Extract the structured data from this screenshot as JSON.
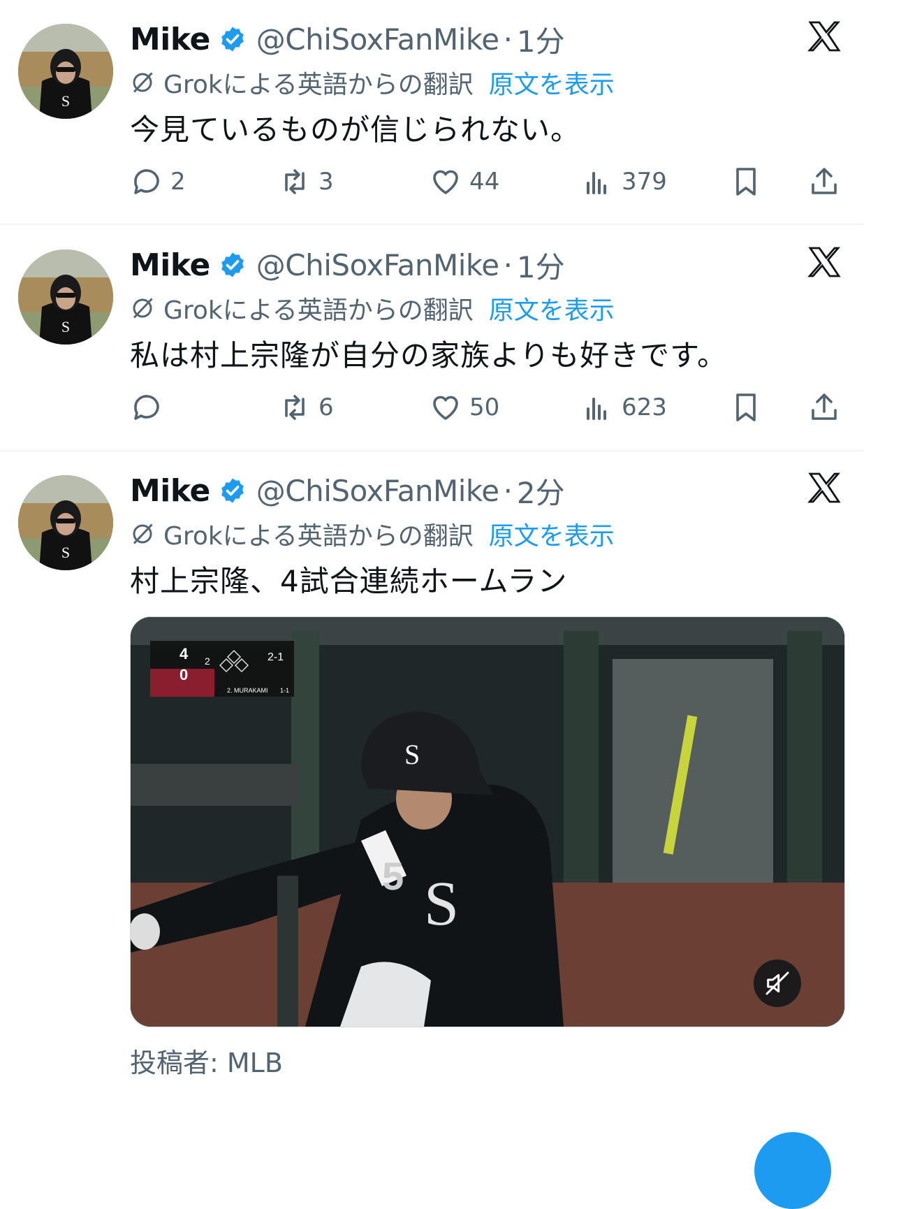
{
  "tweets": [
    {
      "author_name": "Mike",
      "handle": "@ChiSoxFanMike",
      "separator": "·",
      "time": "1分",
      "translation_label": "Grokによる英語からの翻訳",
      "show_original_label": "原文を表示",
      "text": "今見ているものが信じられない。",
      "replies": "2",
      "reposts": "3",
      "likes": "44",
      "views": "379"
    },
    {
      "author_name": "Mike",
      "handle": "@ChiSoxFanMike",
      "separator": "·",
      "time": "1分",
      "translation_label": "Grokによる英語からの翻訳",
      "show_original_label": "原文を表示",
      "text": "私は村上宗隆が自分の家族よりも好きです。",
      "replies": "",
      "reposts": "6",
      "likes": "50",
      "views": "623"
    },
    {
      "author_name": "Mike",
      "handle": "@ChiSoxFanMike",
      "separator": "·",
      "time": "2分",
      "translation_label": "Grokによる英語からの翻訳",
      "show_original_label": "原文を表示",
      "text": "村上宗隆、4試合連続ホームラン",
      "media": {
        "scoreboard": {
          "away_score": "4",
          "home_score": "0",
          "inning": "2",
          "count": "2-1",
          "batter": "2. MURAKAMI",
          "batter_stat": "1-1"
        },
        "jersey_number": "5"
      },
      "attribution": "投稿者: MLB"
    }
  ],
  "colors": {
    "accent": "#1d9bf0",
    "secondary_text": "#536471",
    "primary_text": "#0f1419",
    "divider": "#eff3f4"
  },
  "icons": [
    "verified-badge-icon",
    "x-logo-icon",
    "grok-icon",
    "reply-icon",
    "repost-icon",
    "like-icon",
    "views-icon",
    "bookmark-icon",
    "share-icon",
    "mute-icon"
  ]
}
